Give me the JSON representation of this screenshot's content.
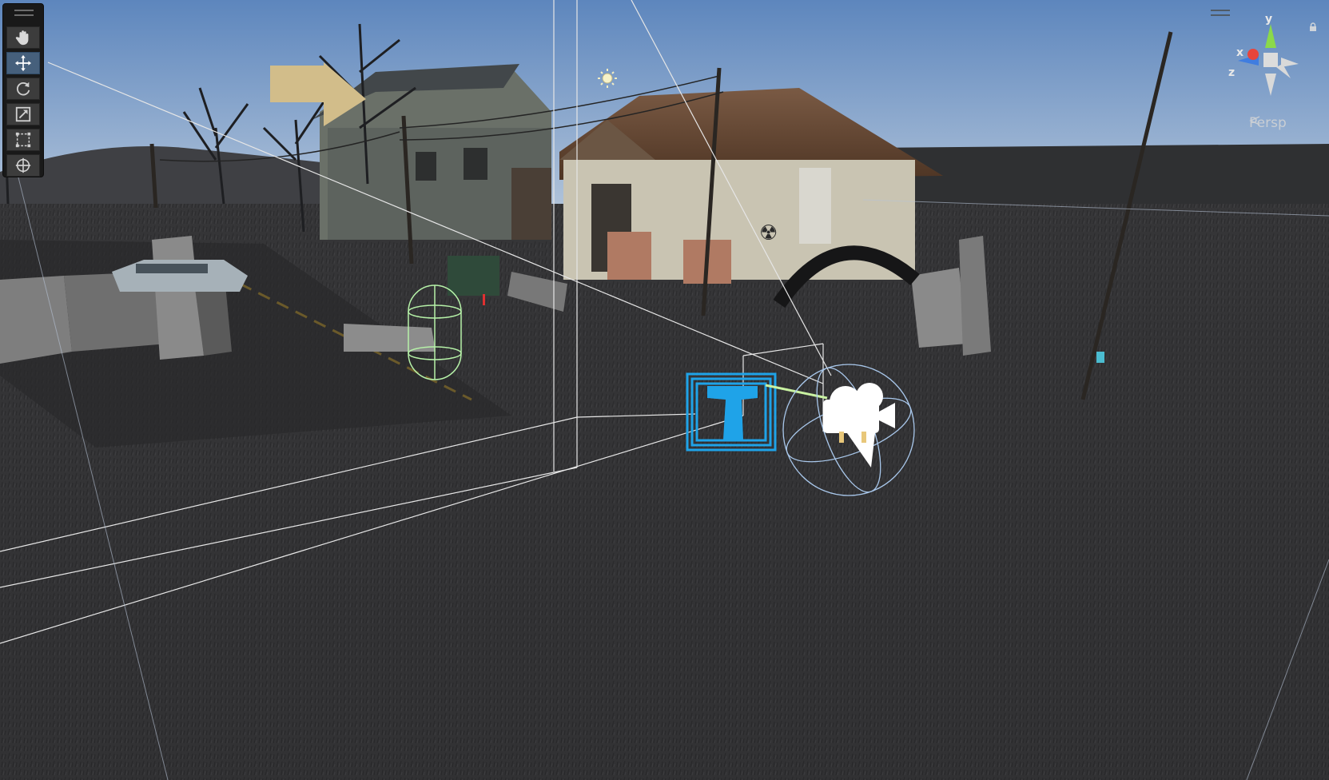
{
  "scene": {
    "camera_mode": "Persp",
    "accent_color": "#46607c"
  },
  "toolbar": {
    "tools": [
      {
        "name": "hand-tool",
        "icon": "hand-icon",
        "active": false
      },
      {
        "name": "move-tool",
        "icon": "move-arrows-icon",
        "active": true
      },
      {
        "name": "rotate-tool",
        "icon": "rotate-icon",
        "active": false
      },
      {
        "name": "scale-tool",
        "icon": "scale-icon",
        "active": false
      },
      {
        "name": "rect-tool",
        "icon": "rect-transform-icon",
        "active": false
      },
      {
        "name": "transform-tool",
        "icon": "transform-icon",
        "active": false
      }
    ]
  },
  "gizmo": {
    "x_label": "x",
    "y_label": "y",
    "z_label": "z",
    "colors": {
      "x": "#e8453c",
      "y": "#8bd94a",
      "z": "#3f7de0"
    }
  },
  "scene_gizmos": [
    "directional-light-icon",
    "camera-icon",
    "audio-source-icon",
    "capsule-collider",
    "sphere-collider",
    "camera-frustum"
  ]
}
